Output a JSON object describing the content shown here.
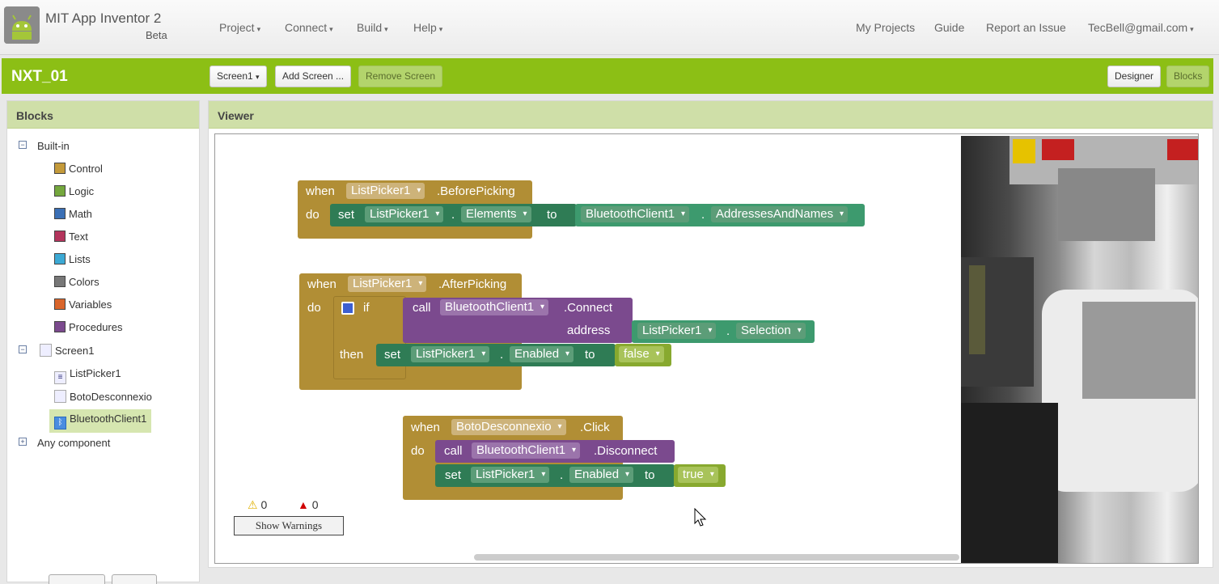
{
  "header": {
    "app_title": "MIT App Inventor 2",
    "app_subtitle": "Beta",
    "menus": [
      "Project",
      "Connect",
      "Build",
      "Help"
    ],
    "right_links": [
      "My Projects",
      "Guide",
      "Report an Issue"
    ],
    "account": "TecBell@gmail.com"
  },
  "project_bar": {
    "project_name": "NXT_01",
    "screen_select": "Screen1",
    "add_screen": "Add Screen ...",
    "remove_screen": "Remove Screen",
    "designer": "Designer",
    "blocks": "Blocks"
  },
  "blocks_panel": {
    "title": "Blocks",
    "builtin_label": "Built-in",
    "builtin_items": [
      {
        "label": "Control",
        "color": "#c49a3a"
      },
      {
        "label": "Logic",
        "color": "#74a73d"
      },
      {
        "label": "Math",
        "color": "#3a6fb5"
      },
      {
        "label": "Text",
        "color": "#b3345c"
      },
      {
        "label": "Lists",
        "color": "#3ca9d4"
      },
      {
        "label": "Colors",
        "color": "#777777"
      },
      {
        "label": "Variables",
        "color": "#d9652b"
      },
      {
        "label": "Procedures",
        "color": "#7b4a8e"
      }
    ],
    "screen_label": "Screen1",
    "components": [
      "ListPicker1",
      "BotoDesconnexio",
      "BluetoothClient1"
    ],
    "any_component": "Any component"
  },
  "viewer": {
    "title": "Viewer",
    "block1": {
      "when": "when",
      "component": "ListPicker1",
      "event": ".BeforePicking",
      "do": "do",
      "set": "set",
      "set_component": "ListPicker1",
      "dot": ".",
      "property": "Elements",
      "to": "to",
      "value_component": "BluetoothClient1",
      "value_property": "AddressesAndNames"
    },
    "block2": {
      "when": "when",
      "component": "ListPicker1",
      "event": ".AfterPicking",
      "do": "do",
      "if": "if",
      "call": "call",
      "call_component": "BluetoothClient1",
      "method": ".Connect",
      "address": "address",
      "addr_component": "ListPicker1",
      "addr_property": "Selection",
      "then": "then",
      "set": "set",
      "set_component": "ListPicker1",
      "property": "Enabled",
      "to": "to",
      "value": "false"
    },
    "block3": {
      "when": "when",
      "component": "BotoDesconnexio",
      "event": ".Click",
      "do": "do",
      "call": "call",
      "call_component": "BluetoothClient1",
      "method": ".Disconnect",
      "set": "set",
      "set_component": "ListPicker1",
      "property": "Enabled",
      "to": "to",
      "value": "true"
    },
    "warnings_count": "0",
    "errors_count": "0",
    "show_warnings": "Show Warnings"
  }
}
